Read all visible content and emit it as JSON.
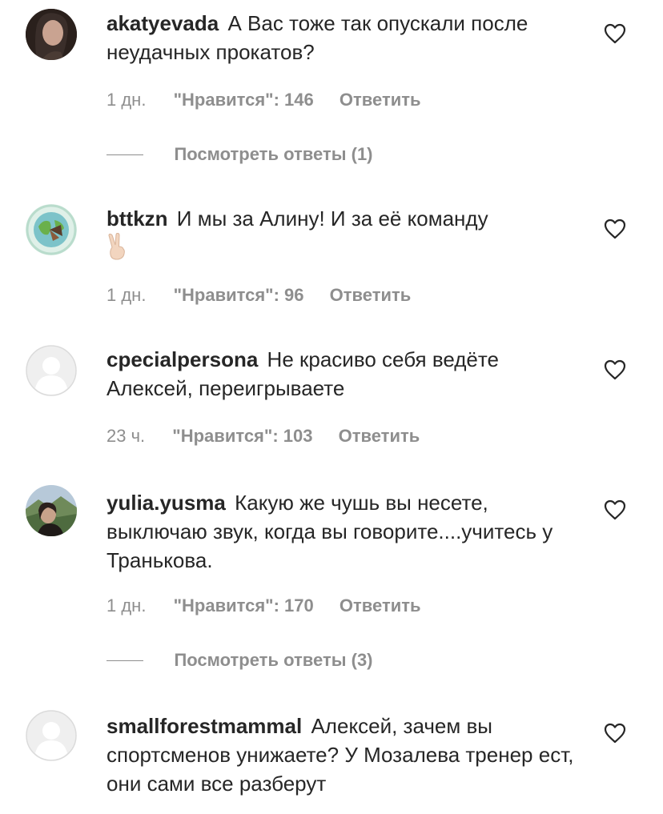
{
  "comments": [
    {
      "username": "akatyevada",
      "text": "А Вас тоже так опускали после неудачных прокатов?",
      "time": "1 дн.",
      "likes": "\"Нравится\": 146",
      "reply_label": "Ответить",
      "view_replies": "Посмотреть ответы (1)"
    },
    {
      "username": "bttkzn",
      "text": "И мы за Алину! И за её команду",
      "emoji": "✌🏻",
      "time": "1 дн.",
      "likes": "\"Нравится\": 96",
      "reply_label": "Ответить"
    },
    {
      "username": "cpecialpersona",
      "text": "Не красиво себя ведёте Алексей, переигрываете",
      "time": "23 ч.",
      "likes": "\"Нравится\": 103",
      "reply_label": "Ответить"
    },
    {
      "username": "yulia.yusma",
      "text": "Какую же чушь вы несете, выключаю звук, когда вы говорите....учитесь у Транькова.",
      "time": "1 дн.",
      "likes": "\"Нравится\": 170",
      "reply_label": "Ответить",
      "view_replies": "Посмотреть ответы (3)"
    },
    {
      "username": "smallforestmammal",
      "text": "Алексей, зачем вы спортсменов унижаете? У Мозалева тренер ест, они сами все разберут"
    }
  ],
  "icons": {
    "like": "heart-outline-icon",
    "default_avatar": "default-avatar-icon"
  },
  "colors": {
    "text": "#262626",
    "secondary": "#8e8e8e",
    "background": "#ffffff"
  }
}
